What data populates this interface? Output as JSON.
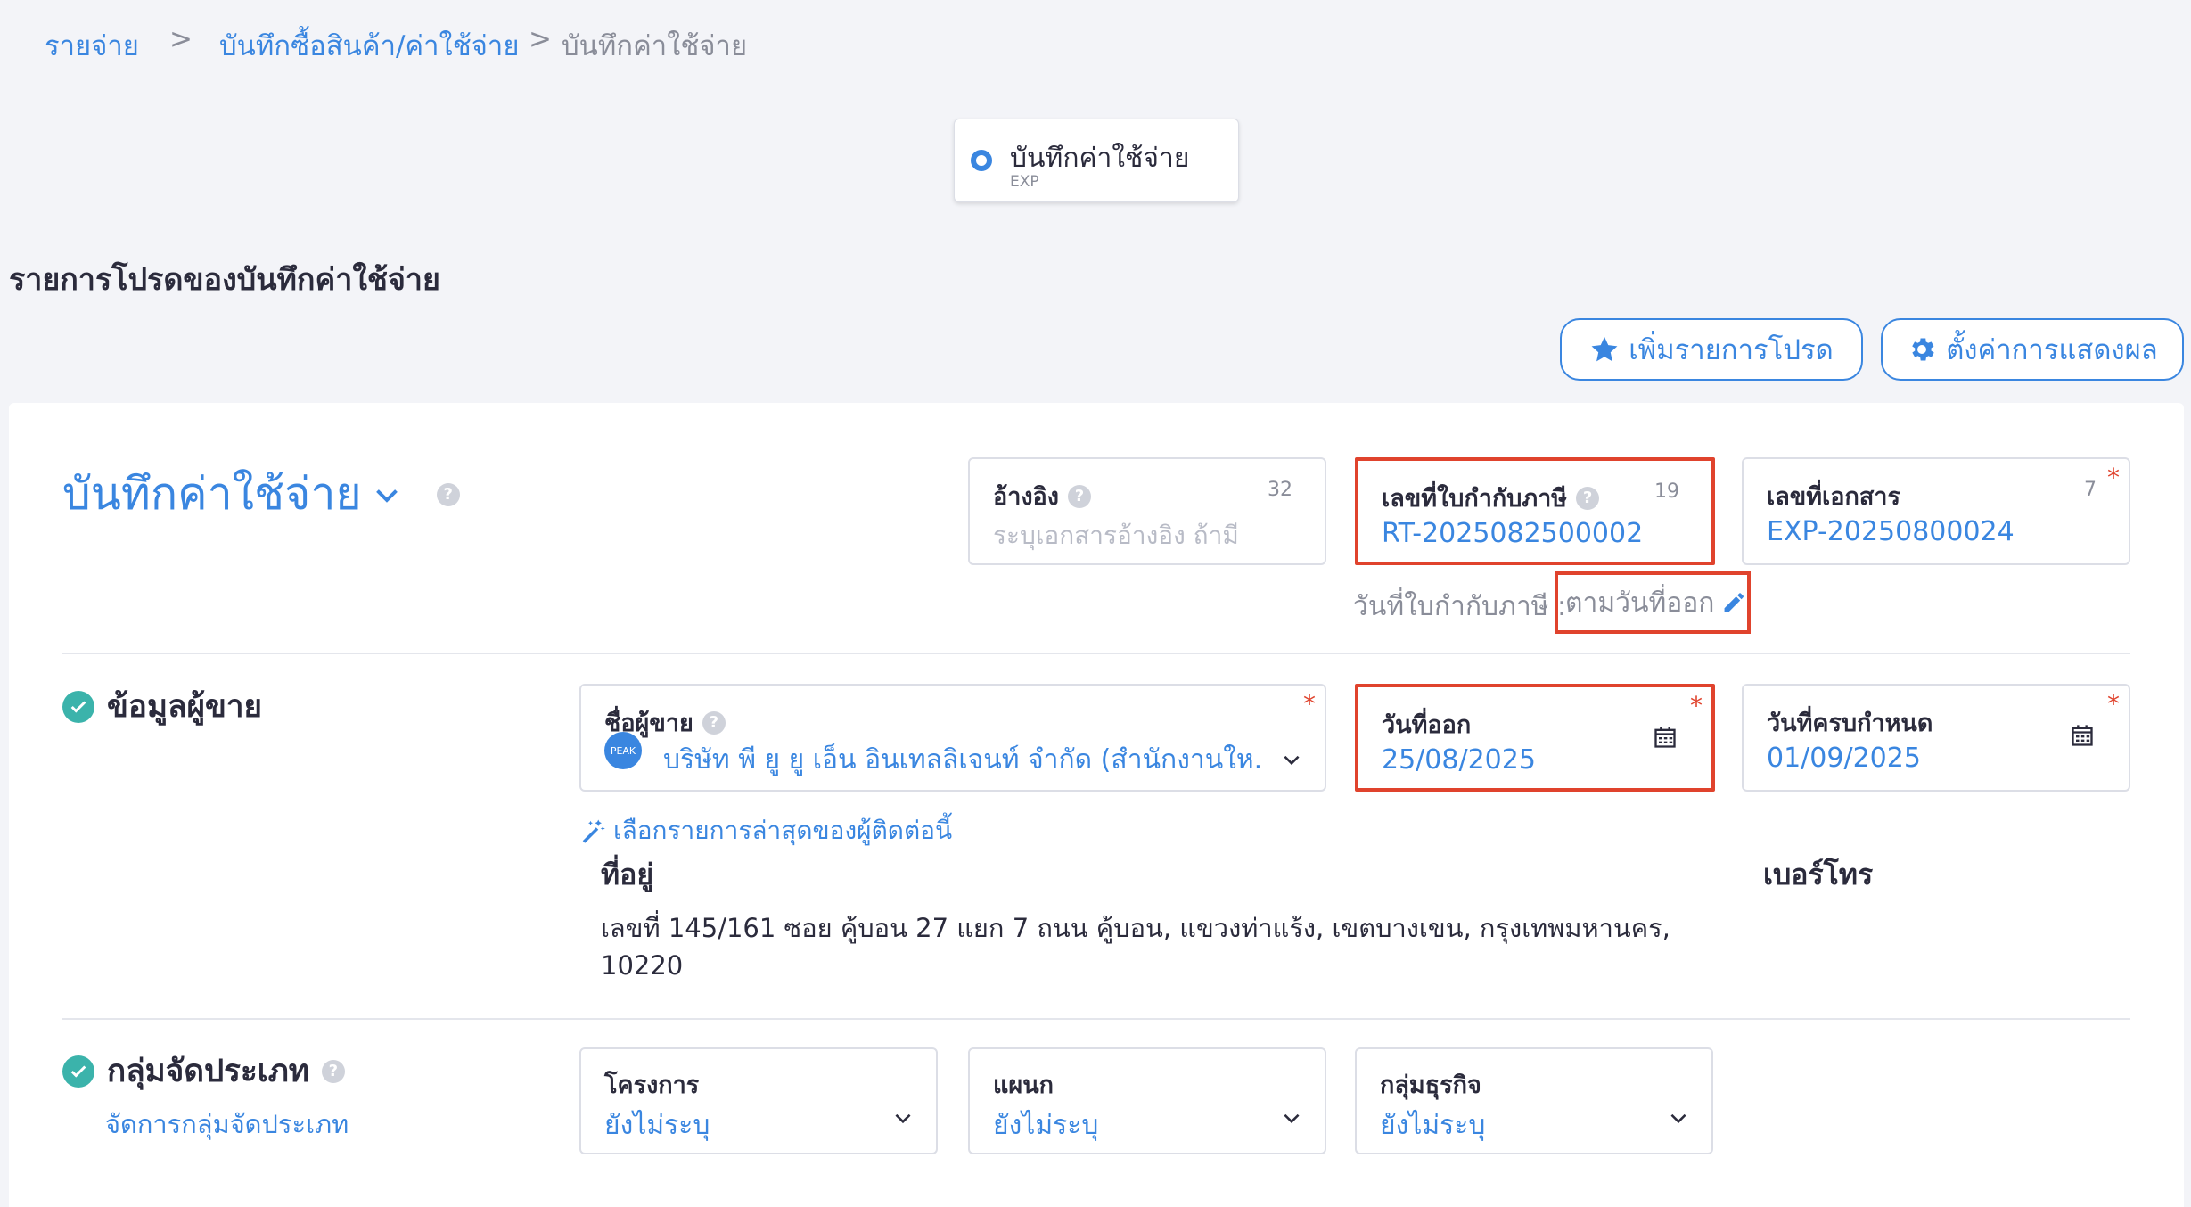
{
  "breadcrumb": {
    "item1": "รายจ่าย",
    "sep": ">",
    "item2": "บันทึกซื้อสินค้า/ค่าใช้จ่าย",
    "current": "บันทึกค่าใช้จ่าย"
  },
  "doc_type": {
    "title": "บันทึกค่าใช้จ่าย",
    "code": "EXP",
    "selected": true
  },
  "favorites": {
    "title": "รายการโปรดของบันทึกค่าใช้จ่าย",
    "add_button": "เพิ่มรายการโปรด",
    "settings_button": "ตั้งค่าการแสดงผล"
  },
  "header": {
    "page_title": "บันทึกค่าใช้จ่าย",
    "help_glyph": "?",
    "reference": {
      "label": "อ้างอิง",
      "count": "32",
      "placeholder": "ระบุเอกสารอ้างอิง ถ้ามี"
    },
    "tax_invoice_no": {
      "label": "เลขที่ใบกำกับภาษี",
      "count": "19",
      "value": "RT-2025082500002"
    },
    "document_no": {
      "label": "เลขที่เอกสาร",
      "count": "7",
      "value": "EXP-20250800024",
      "required": "*"
    },
    "tax_invoice_date": {
      "label": "วันที่ใบกำกับภาษี :",
      "value": "ตามวันที่ออก"
    }
  },
  "vendor": {
    "section_title": "ข้อมูลผู้ขาย",
    "name_field": {
      "label": "ชื่อผู้ขาย",
      "avatar_text": "PEAK",
      "value": "บริษัท พี ยู ยู เอ็น อินเทลลิเจนท์ จำกัด (สำนักงานให...",
      "required": "*"
    },
    "issue_date": {
      "label": "วันที่ออก",
      "value": "25/08/2025",
      "required": "*"
    },
    "due_date": {
      "label": "วันที่ครบกำหนด",
      "value": "01/09/2025",
      "required": "*"
    },
    "latest_link": "เลือกรายการล่าสุดของผู้ติดต่อนี้",
    "address_label": "ที่อยู่",
    "address_line1": "เลขที่ 145/161 ซอย คู้บอน 27 แยก 7 ถนน คู้บอน, แขวงท่าแร้ง, เขตบางเขน, กรุงเทพมหานคร,",
    "address_line2": "10220",
    "phone_label": "เบอร์โทร"
  },
  "classification": {
    "section_title": "กลุ่มจัดประเภท",
    "manage_link": "จัดการกลุ่มจัดประเภท",
    "project": {
      "label": "โครงการ",
      "value": "ยังไม่ระบุ"
    },
    "department": {
      "label": "แผนก",
      "value": "ยังไม่ระบุ"
    },
    "business_group": {
      "label": "กลุ่มธุรกิจ",
      "value": "ยังไม่ระบุ"
    }
  },
  "colors": {
    "accent": "#3a86e0",
    "highlight": "#e0432d",
    "success": "#3bb3ab"
  }
}
